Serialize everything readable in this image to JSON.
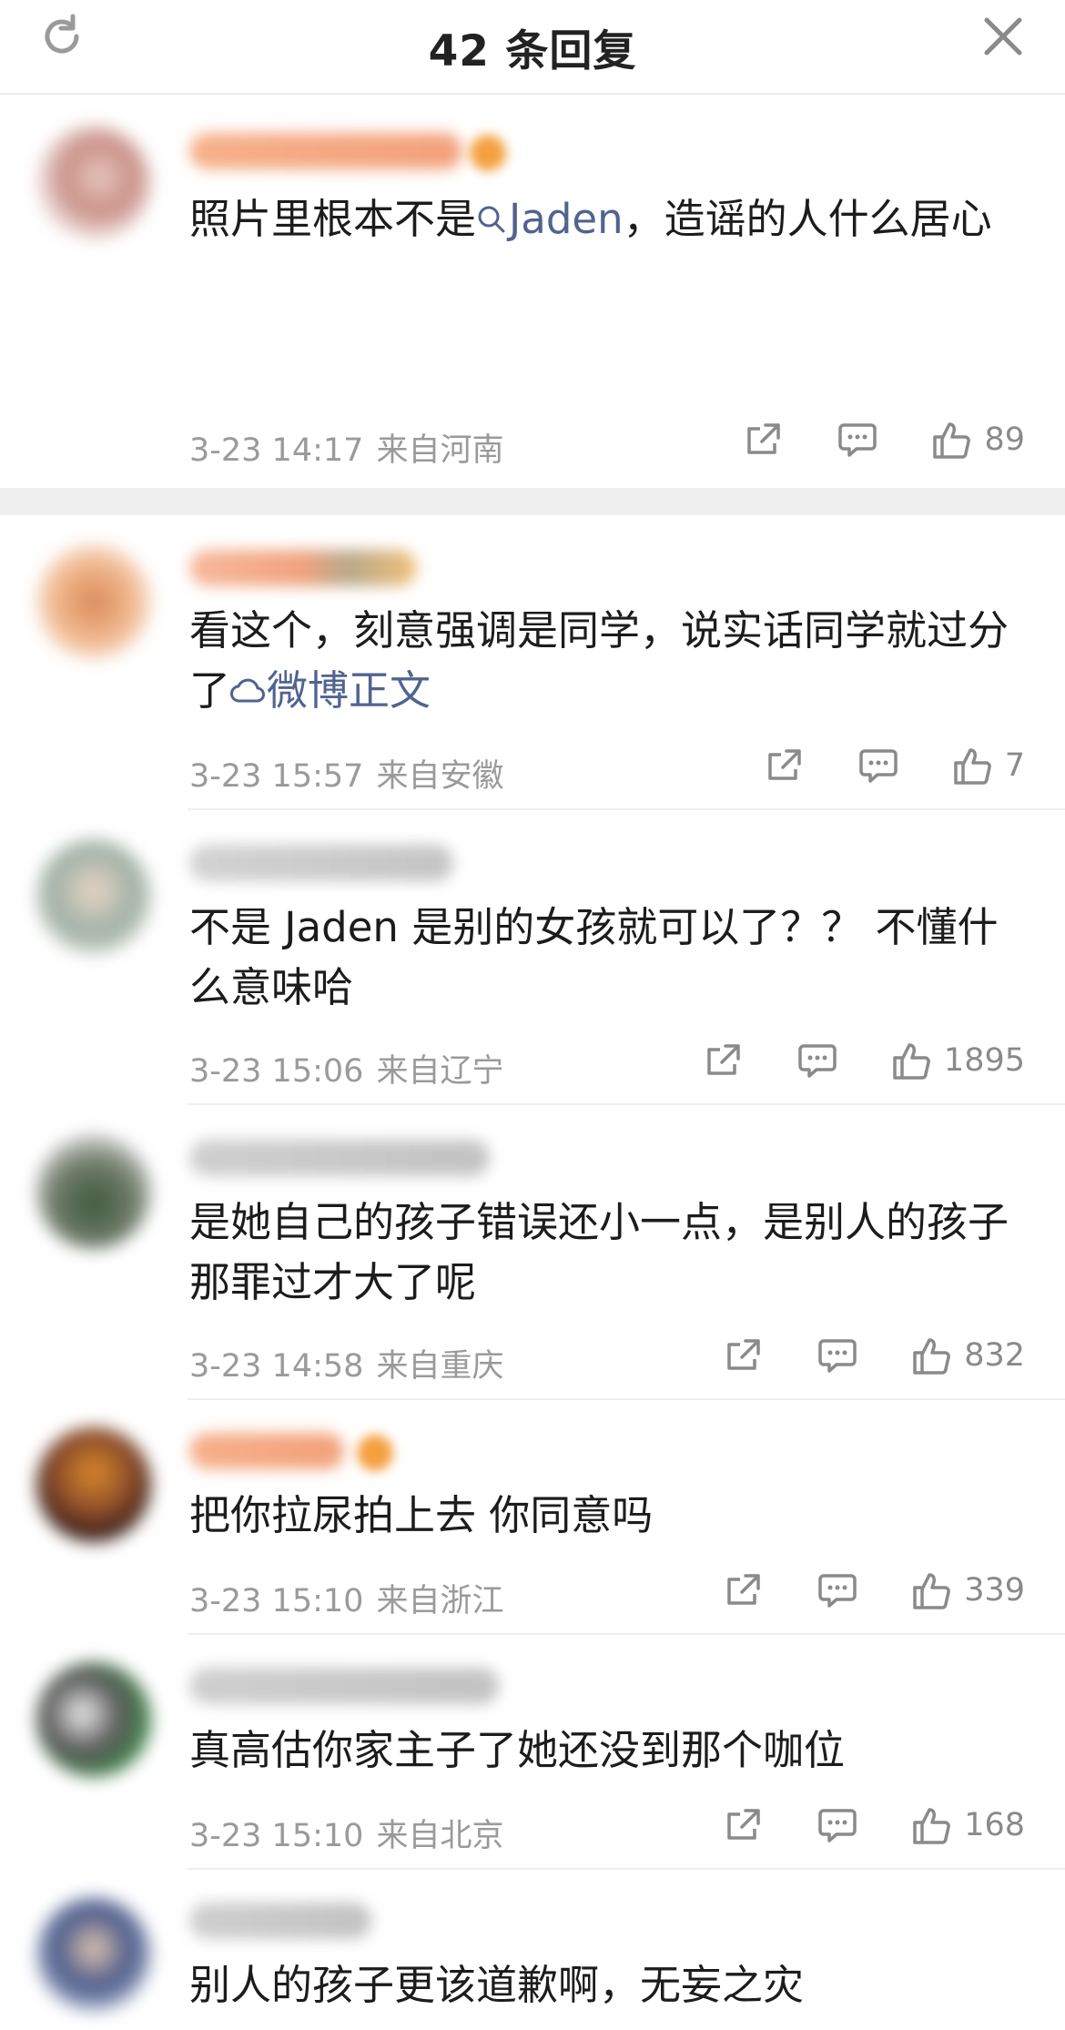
{
  "header": {
    "title": "42 条回复",
    "refresh_icon": "refresh-icon",
    "close_icon": "close-icon"
  },
  "comments": [
    {
      "text_before": "照片里根本不是",
      "link": {
        "icon": "search-icon",
        "label": "Jaden"
      },
      "text_after": "，造谣的人什么居心",
      "time": "3-23 14:17",
      "region": "来自河南",
      "likes": "89"
    },
    {
      "text_before": "看这个，刻意强调是同学，说实话同学就过分了",
      "link": {
        "icon": "link-icon",
        "label": "微博正文"
      },
      "text_after": "",
      "time": "3-23 15:57",
      "region": "来自安徽",
      "likes": "7"
    },
    {
      "text": "不是 Jaden 是别的女孩就可以了？？ 不懂什么意味哈",
      "time": "3-23 15:06",
      "region": "来自辽宁",
      "likes": "1895"
    },
    {
      "text": "是她自己的孩子错误还小一点，是别人的孩子那罪过才大了呢",
      "time": "3-23 14:58",
      "region": "来自重庆",
      "likes": "832"
    },
    {
      "text": "把你拉尿拍上去 你同意吗",
      "time": "3-23 15:10",
      "region": "来自浙江",
      "likes": "339"
    },
    {
      "text": "真高估你家主子了她还没到那个咖位",
      "time": "3-23 15:10",
      "region": "来自北京",
      "likes": "168"
    },
    {
      "text": "别人的孩子更该道歉啊，无妄之灾"
    }
  ],
  "colors": {
    "link": "#51638f",
    "meta": "#9a9a9a",
    "divider": "#efefef"
  }
}
